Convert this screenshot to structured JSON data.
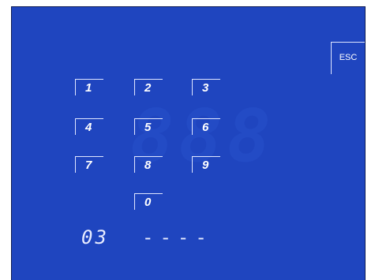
{
  "keypad": {
    "keys": [
      "1",
      "2",
      "3",
      "4",
      "5",
      "6",
      "7",
      "8",
      "9",
      "0"
    ]
  },
  "esc_label": "ESC",
  "display": {
    "code": "03",
    "pin": "----"
  },
  "colors": {
    "screen_bg": "#1f45bf",
    "key_text": "#ffffff",
    "display_text": "#e8ecff"
  }
}
